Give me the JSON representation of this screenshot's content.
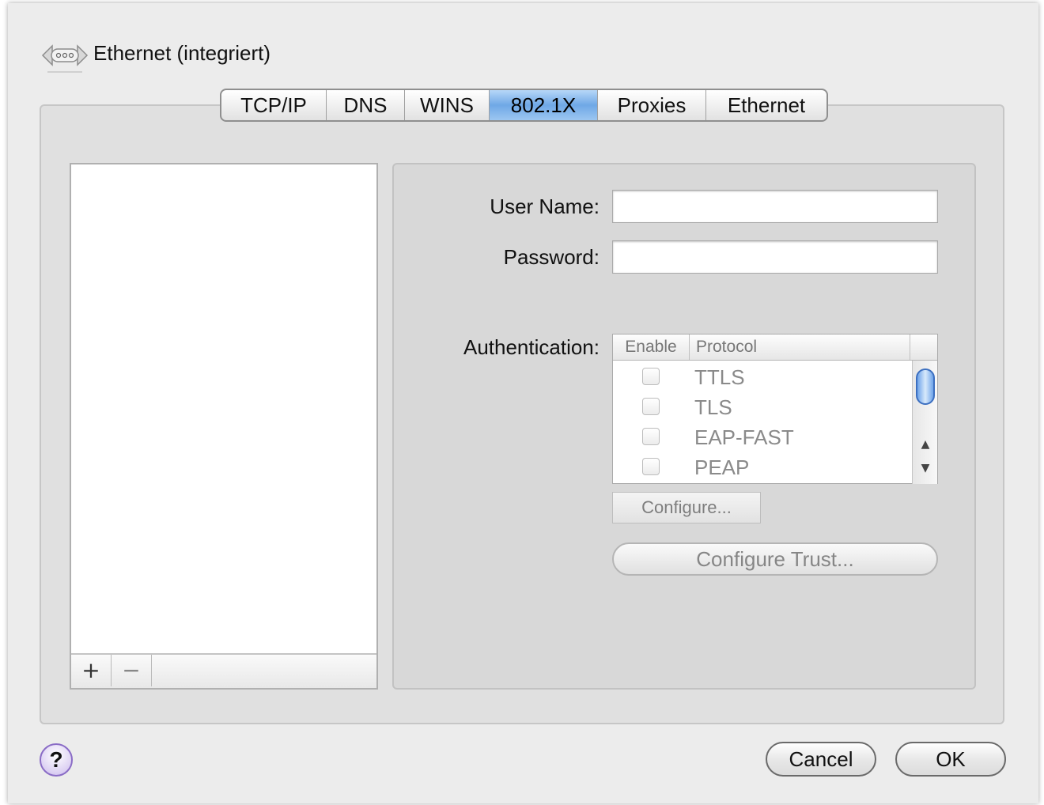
{
  "window": {
    "title": "Ethernet (integriert)",
    "icon": "ethernet-icon"
  },
  "tabs": [
    {
      "label": "TCP/IP",
      "active": false
    },
    {
      "label": "DNS",
      "active": false
    },
    {
      "label": "WINS",
      "active": false
    },
    {
      "label": "802.1X",
      "active": true
    },
    {
      "label": "Proxies",
      "active": false
    },
    {
      "label": "Ethernet",
      "active": false
    }
  ],
  "profile_list": {
    "items": [],
    "add_label": "+",
    "remove_label": "−"
  },
  "form": {
    "username_label": "User Name:",
    "username_value": "",
    "password_label": "Password:",
    "password_value": "",
    "authentication_label": "Authentication:"
  },
  "auth_table": {
    "columns": [
      "Enable",
      "Protocol"
    ],
    "rows": [
      {
        "protocol": "TTLS",
        "enabled": false
      },
      {
        "protocol": "TLS",
        "enabled": false
      },
      {
        "protocol": "EAP-FAST",
        "enabled": false
      },
      {
        "protocol": "PEAP",
        "enabled": false
      }
    ]
  },
  "buttons": {
    "configure": "Configure...",
    "configure_trust": "Configure Trust...",
    "help": "?",
    "cancel": "Cancel",
    "ok": "OK"
  },
  "colors": {
    "active_tab": "#6fa8e6",
    "window_bg": "#ececec",
    "help_accent": "#8a6cc6"
  }
}
